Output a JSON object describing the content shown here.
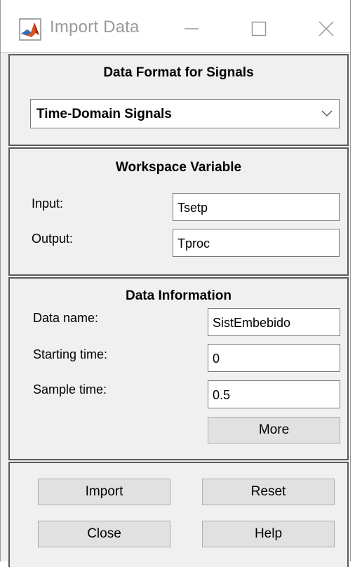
{
  "window": {
    "title": "Import Data",
    "icon": "matlab-icon",
    "controls": [
      "minimize-icon",
      "maximize-icon",
      "close-icon"
    ]
  },
  "data_format": {
    "heading": "Data Format for Signals",
    "selected": "Time-Domain Signals"
  },
  "workspace": {
    "heading": "Workspace Variable",
    "input_label": "Input:",
    "input_value": "Tsetp",
    "output_label": "Output:",
    "output_value": "Tproc"
  },
  "data_info": {
    "heading": "Data Information",
    "name_label": "Data name:",
    "name_value": "SistEmbebido",
    "start_label": "Starting time:",
    "start_value": "0",
    "sample_label": "Sample time:",
    "sample_value": "0.5",
    "more_label": "More"
  },
  "actions": {
    "import_label": "Import",
    "reset_label": "Reset",
    "close_label": "Close",
    "help_label": "Help"
  },
  "colors": {
    "background": "#f0f0f0",
    "titlebar": "#ffffff",
    "button": "#e1e1e1",
    "panel_border": "#5a5a5a"
  }
}
